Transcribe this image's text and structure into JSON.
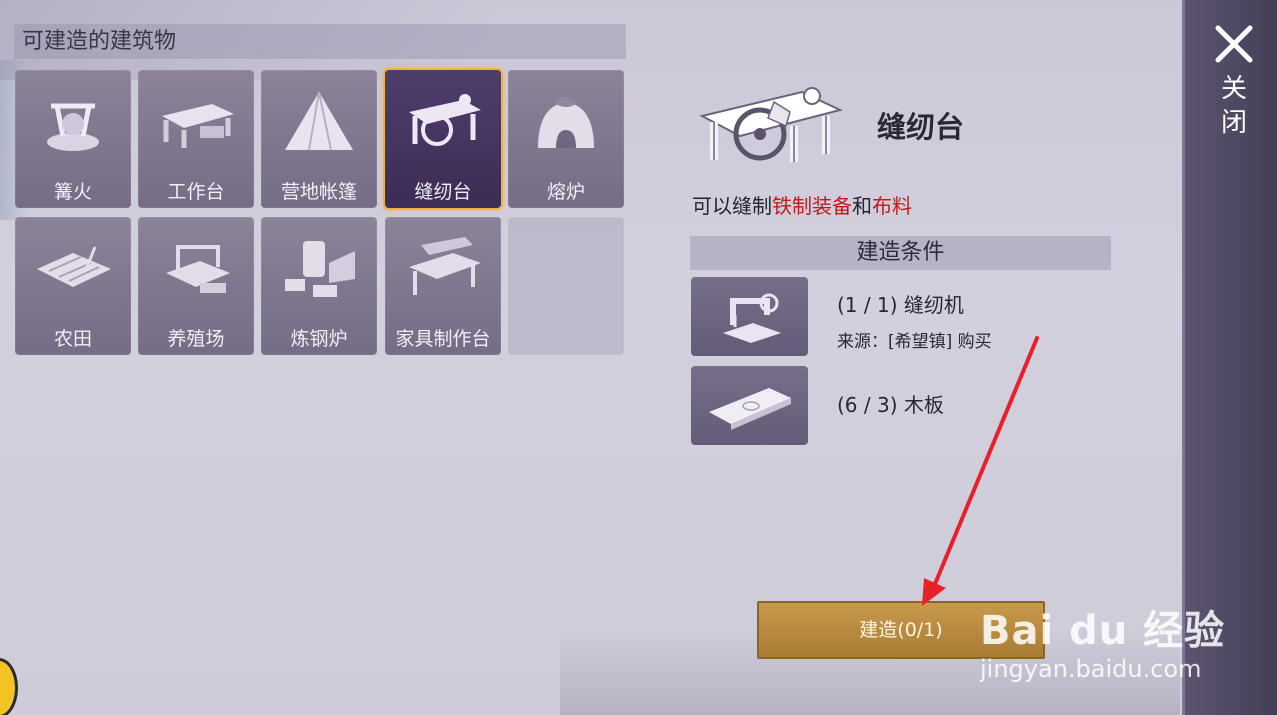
{
  "header": {
    "title": "可建造的建筑物"
  },
  "buildings": [
    {
      "label": "篝火",
      "icon": "campfire-icon"
    },
    {
      "label": "工作台",
      "icon": "workbench-icon"
    },
    {
      "label": "营地帐篷",
      "icon": "tent-icon"
    },
    {
      "label": "缝纫台",
      "icon": "sewing-table-icon",
      "selected": true
    },
    {
      "label": "熔炉",
      "icon": "furnace-icon"
    },
    {
      "label": "农田",
      "icon": "farmland-icon"
    },
    {
      "label": "养殖场",
      "icon": "ranch-icon"
    },
    {
      "label": "炼钢炉",
      "icon": "steel-furnace-icon"
    },
    {
      "label": "家具制作台",
      "icon": "furniture-bench-icon"
    }
  ],
  "detail": {
    "title": "缝纫台",
    "desc_prefix": "可以缝制",
    "desc_item1": "铁制装备",
    "desc_join": "和",
    "desc_item2": "布料",
    "requirements_title": "建造条件",
    "requirements": [
      {
        "text": "(1 / 1) 缝纫机",
        "sub": "来源：[希望镇] 购买",
        "icon": "sewing-machine-icon"
      },
      {
        "text": "(6 / 3) 木板",
        "icon": "wood-plank-icon"
      }
    ]
  },
  "build_button": {
    "label": "建造(0/1)"
  },
  "close": {
    "label": "关闭"
  },
  "watermark": {
    "logo": "Bai du 经验",
    "url": "jingyan.baidu.com"
  },
  "colors": {
    "highlight": "#c21a1a",
    "selected_border": "#f0b33a",
    "button": "#b88a3f",
    "arrow": "#e8202a"
  }
}
